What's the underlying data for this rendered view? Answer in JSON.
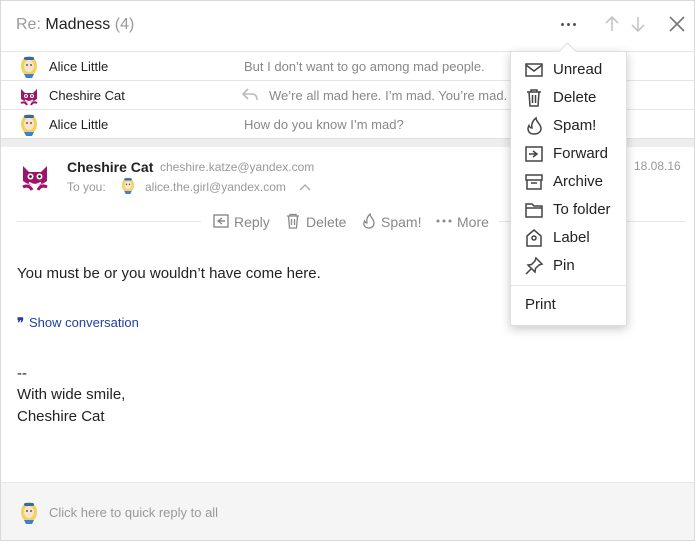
{
  "header": {
    "subject_prefix": "Re:",
    "subject": "Madness",
    "count": "(4)",
    "more_icon": "more-dots-icon",
    "prev_icon": "arrow-up-icon",
    "next_icon": "arrow-down-icon",
    "close_icon": "close-icon"
  },
  "thread": [
    {
      "from": "Alice Little",
      "snippet": "But I don’t want to go among mad people.",
      "avatar": "alice-avatar",
      "replied": false
    },
    {
      "from": "Cheshire Cat",
      "snippet": "We’re all mad here. I’m mad. You’re mad.",
      "avatar": "cheshire-cat-avatar",
      "replied": true
    },
    {
      "from": "Alice Little",
      "snippet": "How do you know I’m mad?",
      "avatar": "alice-avatar",
      "replied": false
    }
  ],
  "message": {
    "from_name": "Cheshire Cat",
    "from_email": "cheshire.katze@yandex.com",
    "to_label": "To you:",
    "to_email": "alice.the.girl@yandex.com",
    "date": "18.08.16",
    "actions": {
      "reply": "Reply",
      "delete": "Delete",
      "spam": "Spam!",
      "more": "More"
    },
    "body_line": "You must be or you wouldn’t have come here.",
    "show_conversation": "Show conversation",
    "signature": [
      "--",
      "With wide smile,",
      "Cheshire Cat"
    ]
  },
  "quick_reply": {
    "placeholder": "Click here to quick reply to all"
  },
  "menu": {
    "items": [
      {
        "label": "Unread",
        "icon": "envelope-icon"
      },
      {
        "label": "Delete",
        "icon": "trash-icon"
      },
      {
        "label": "Spam!",
        "icon": "flame-icon"
      },
      {
        "label": "Forward",
        "icon": "forward-icon"
      },
      {
        "label": "Archive",
        "icon": "archive-icon"
      },
      {
        "label": "To folder",
        "icon": "folder-icon"
      },
      {
        "label": "Label",
        "icon": "label-icon"
      },
      {
        "label": "Pin",
        "icon": "pin-icon"
      }
    ],
    "print": "Print"
  },
  "colors": {
    "link": "#1f3fa6",
    "muted": "#999999",
    "cat": "#a0136b"
  }
}
